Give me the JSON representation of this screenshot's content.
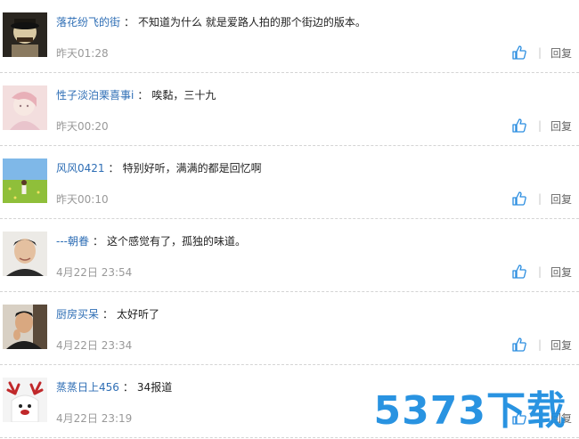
{
  "comments": [
    {
      "username": "落花纷飞的街",
      "content": "不知道为什么 就是爱路人拍的那个街边的版本。",
      "time": "昨天01:28",
      "reply_label": "回复"
    },
    {
      "username": "性子淡泊栗喜事i",
      "content": "唉黏，三十九",
      "time": "昨天00:20",
      "reply_label": "回复"
    },
    {
      "username": "风风0421",
      "content": "特别好听，满满的都是回忆啊",
      "time": "昨天00:10",
      "reply_label": "回复"
    },
    {
      "username": "---朝眷",
      "content": "这个感觉有了，孤独的味道。",
      "time": "4月22日 23:54",
      "reply_label": "回复"
    },
    {
      "username": "厨房买呆",
      "content": "太好听了",
      "time": "4月22日 23:34",
      "reply_label": "回复"
    },
    {
      "username": "蒸蒸日上456",
      "content": "34报道",
      "time": "4月22日 23:19",
      "reply_label": "回复"
    }
  ],
  "colon": "：",
  "watermark": "5373下载",
  "colors": {
    "username": "#2e6eb5",
    "time": "#999999",
    "like_icon": "#2a8de0",
    "watermark": "#1e8ee0"
  },
  "icons": {
    "like": "thumbs-up-icon"
  }
}
